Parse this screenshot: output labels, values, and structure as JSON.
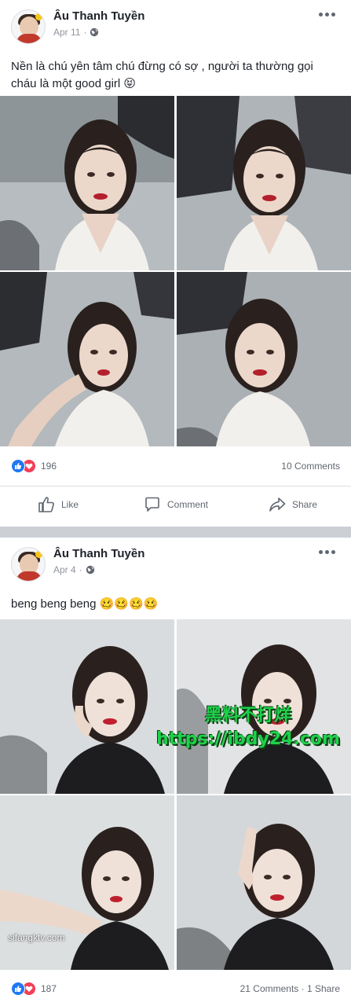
{
  "posts": [
    {
      "author": "Âu Thanh Tuyền",
      "date": "Apr 11",
      "dot": "·",
      "caption": "Nền là chú yên tâm chú đừng có sợ , người ta thường gọi cháu là một good girl 😝",
      "reactions_count": "196",
      "comments": "10 Comments",
      "actions": {
        "like": "Like",
        "comment": "Comment",
        "share": "Share"
      }
    },
    {
      "author": "Âu Thanh Tuyền",
      "date": "Apr 4",
      "dot": "·",
      "caption": "beng beng beng 🥴🥴🥴🥴",
      "reactions_count": "187",
      "comments": "21 Comments · 1 Share"
    }
  ],
  "overlays": {
    "watermark_line1": "黑料不打烊",
    "watermark_line2": "https://ibdy24.com",
    "credit": "sifangktv.com"
  },
  "colors": {
    "like_blue": "#2078f4",
    "love_red": "#f33e58",
    "separator": "#ccd0d5",
    "watermark_green": "#1fd14a"
  },
  "icons": [
    "more-icon",
    "globe-icon",
    "like-reaction-icon",
    "love-reaction-icon",
    "thumbs-up-icon",
    "comment-icon",
    "share-icon"
  ]
}
